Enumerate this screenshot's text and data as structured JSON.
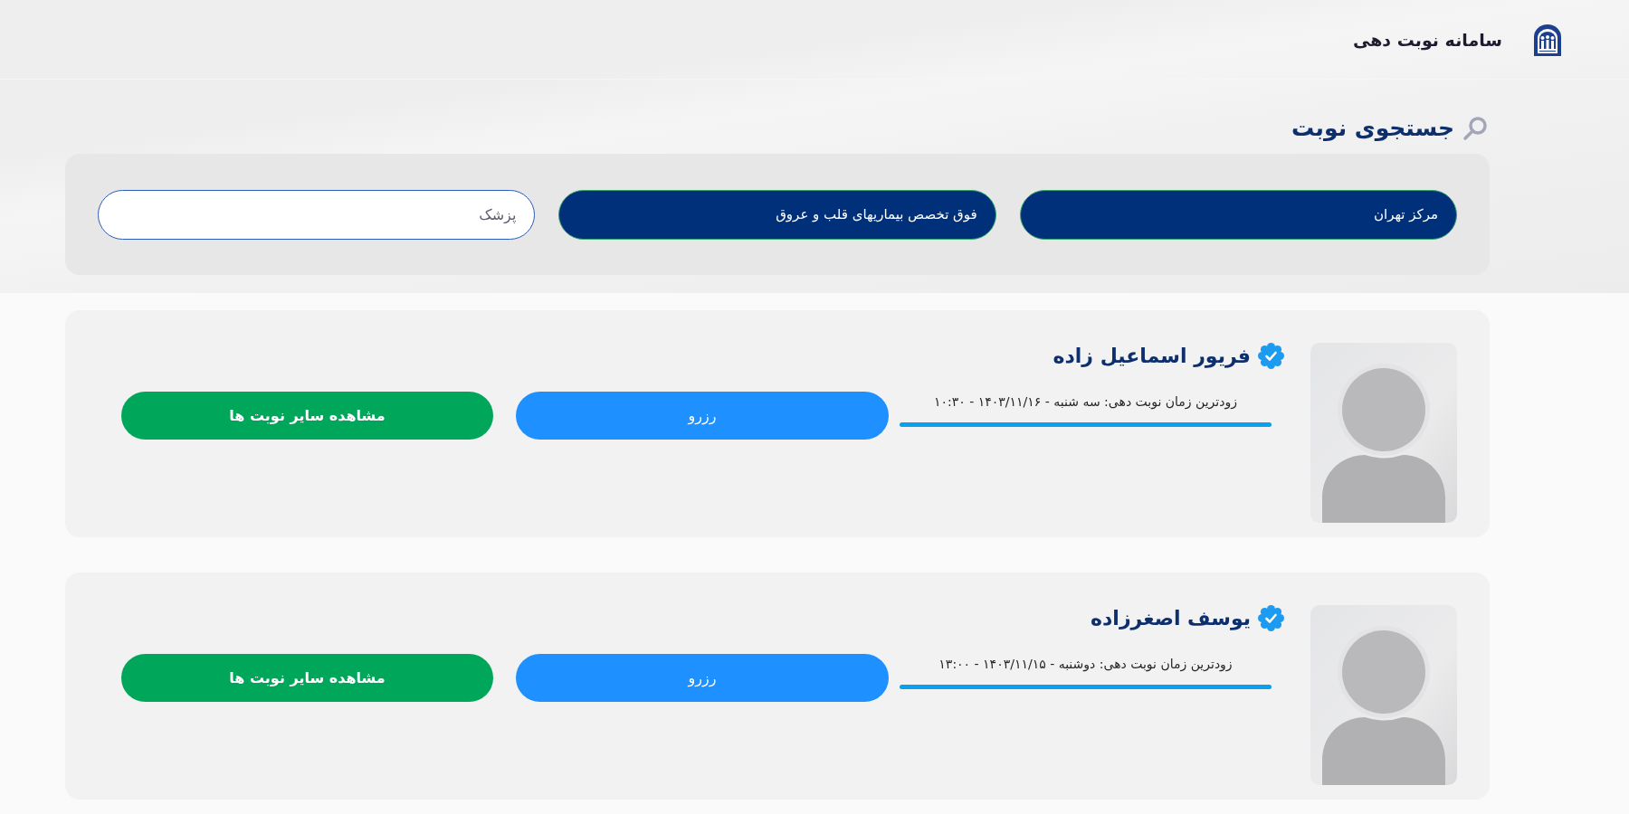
{
  "header": {
    "title": "سامانه نوبت دهی"
  },
  "search": {
    "title": "جستجوی نوبت",
    "filters": [
      {
        "kind": "select",
        "value": "مرکز تهران"
      },
      {
        "kind": "select",
        "value": "فوق تخصص بیماریهای قلب و عروق"
      },
      {
        "kind": "input",
        "placeholder": "پزشک"
      }
    ]
  },
  "doctors": [
    {
      "name": "فریور اسماعیل زاده",
      "verified": true,
      "earliest_slot": "زودترین زمان نوبت دهی: سه شنبه - ۱۴۰۳/۱۱/۱۶ - ۱۰:۳۰",
      "reserve_button": "رزرو",
      "more_button": "مشاهده سایر نوبت ها"
    },
    {
      "name": "یوسف اصغرزاده",
      "verified": true,
      "earliest_slot": "زودترین زمان نوبت دهی: دوشنبه - ۱۴۰۳/۱۱/۱۵ - ۱۳:۰۰",
      "reserve_button": "رزرو",
      "more_button": "مشاهده سایر نوبت ها"
    }
  ]
}
